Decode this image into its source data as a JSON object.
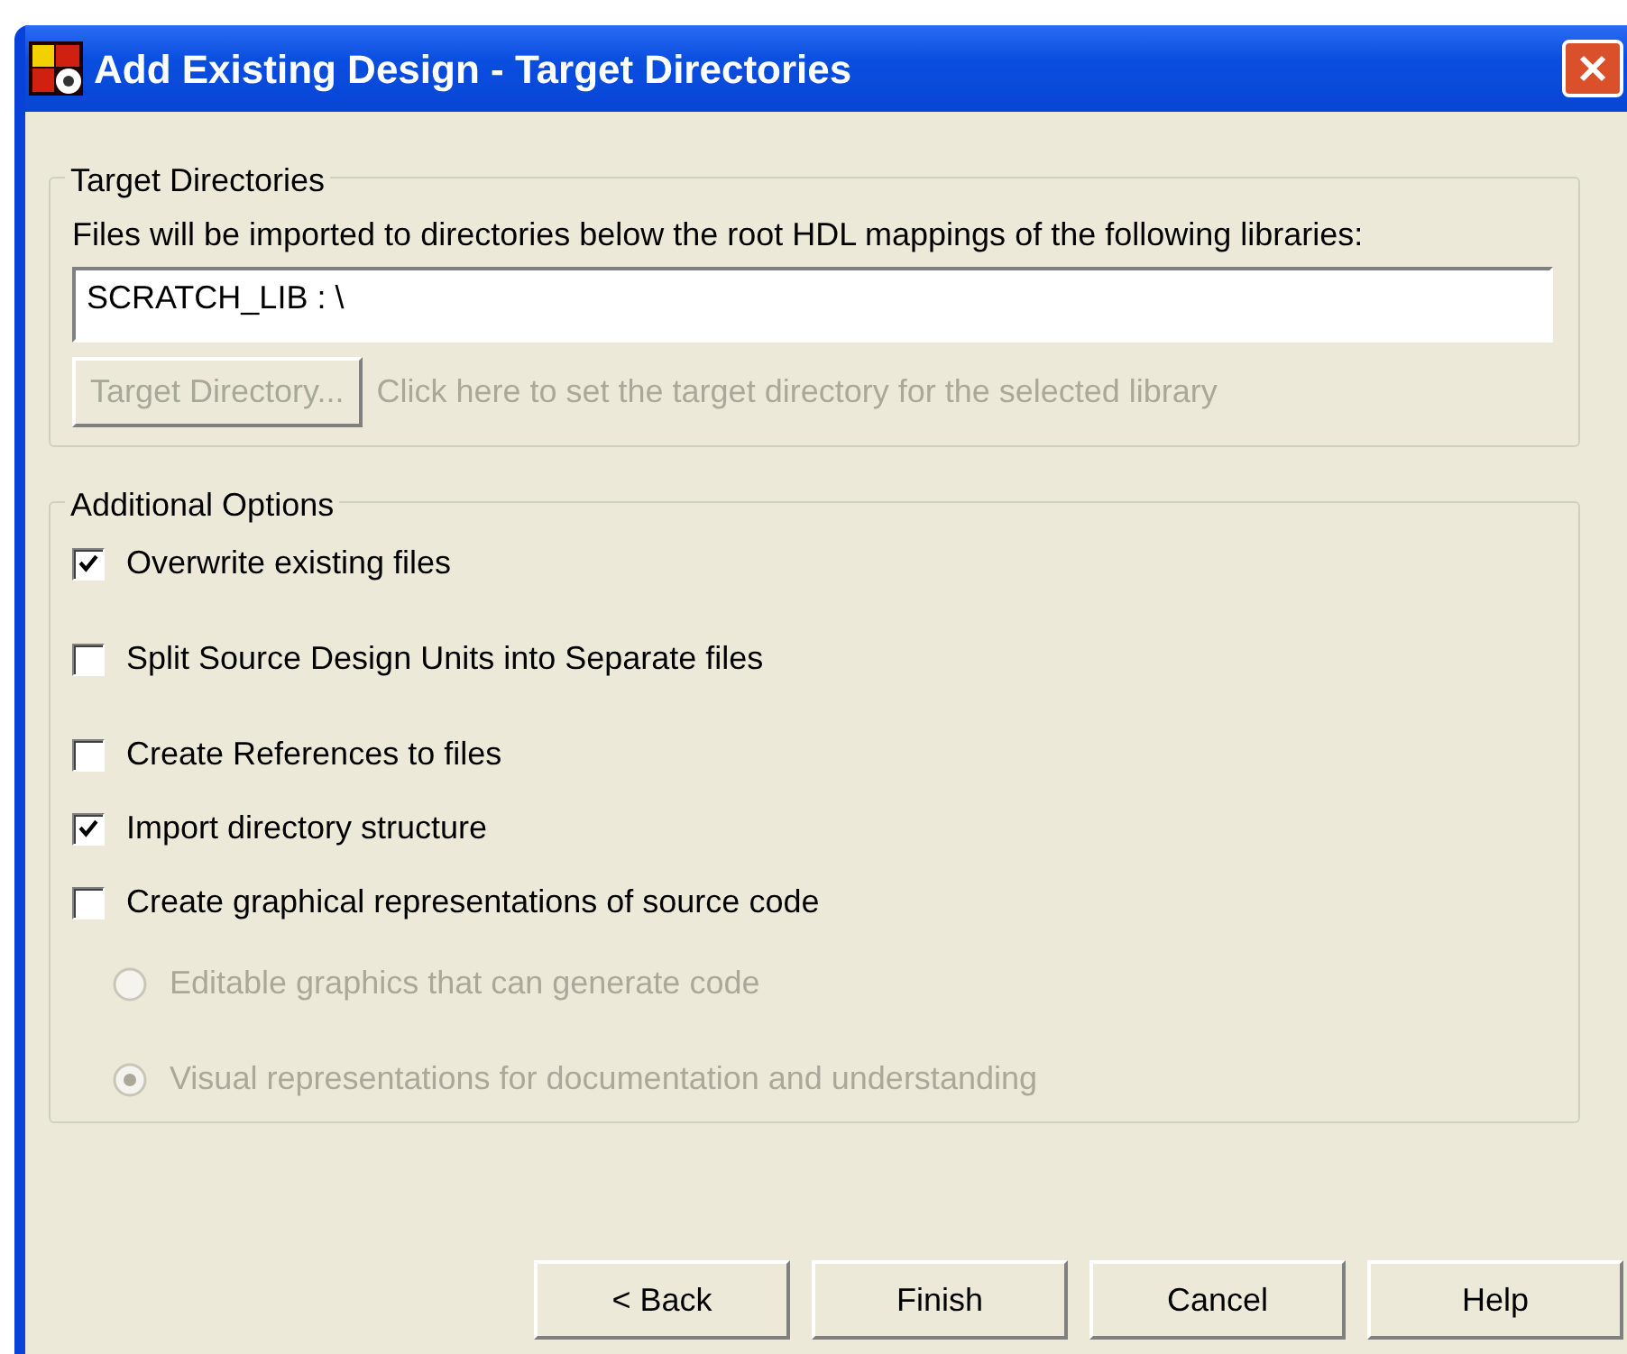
{
  "window": {
    "title": "Add Existing Design - Target Directories"
  },
  "target_directories": {
    "title": "Target Directories",
    "description": "Files will be imported to directories below the root HDL mappings of the following libraries:",
    "libraries": [
      {
        "label": "SCRATCH_LIB : \\",
        "selected": false
      }
    ],
    "button": {
      "label": "Target Directory...",
      "disabled": true
    },
    "hint": {
      "text": "Click here to set the target directory for the selected library",
      "disabled": true
    }
  },
  "additional_options": {
    "title": "Additional Options",
    "options": [
      {
        "kind": "checkbox",
        "label": "Overwrite existing files",
        "checked": true,
        "disabled": false
      },
      {
        "kind": "checkbox",
        "label": "Split Source Design Units into Separate files",
        "checked": false,
        "disabled": false
      },
      {
        "kind": "checkbox",
        "label": "Create References to files",
        "checked": false,
        "disabled": false
      },
      {
        "kind": "checkbox",
        "label": "Import directory structure",
        "checked": true,
        "disabled": false
      },
      {
        "kind": "checkbox",
        "label": "Create graphical representations of source code",
        "checked": false,
        "disabled": false
      },
      {
        "kind": "radio",
        "label": "Editable graphics that can generate code",
        "selected": false,
        "disabled": true
      },
      {
        "kind": "radio",
        "label": "Visual representations for documentation and understanding",
        "selected": true,
        "disabled": true
      }
    ]
  },
  "buttons": [
    {
      "label": "< Back"
    },
    {
      "label": "Finish"
    },
    {
      "label": "Cancel"
    },
    {
      "label": "Help"
    }
  ]
}
